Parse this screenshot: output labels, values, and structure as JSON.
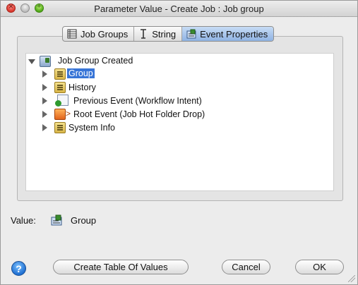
{
  "window": {
    "title": "Parameter Value - Create Job : Job group"
  },
  "tabs": [
    {
      "label": "Job Groups",
      "icon": "table-icon",
      "active": false
    },
    {
      "label": "String",
      "icon": "text-cursor-icon",
      "active": false
    },
    {
      "label": "Event Properties",
      "icon": "network-icon",
      "active": true
    }
  ],
  "tree": {
    "root": {
      "label": "Job Group Created",
      "icon": "network-icon",
      "expanded": true
    },
    "items": [
      {
        "label": "Group",
        "icon": "folder-icon",
        "selected": true
      },
      {
        "label": "History",
        "icon": "folder-icon",
        "selected": false
      },
      {
        "label": "Previous Event (Workflow Intent)",
        "icon": "document-check-icon",
        "selected": false
      },
      {
        "label": "Root Event (Job Hot Folder Drop)",
        "icon": "orange-box-icon",
        "selected": false
      },
      {
        "label": "System Info",
        "icon": "folder-icon",
        "selected": false
      }
    ]
  },
  "value": {
    "label": "Value:",
    "icon": "network-icon",
    "text": "Group"
  },
  "buttons": {
    "help": "?",
    "create_table": "Create Table Of Values",
    "cancel": "Cancel",
    "ok": "OK"
  },
  "colors": {
    "selection": "#3875d7",
    "active_tab": "#8fb3e3"
  }
}
